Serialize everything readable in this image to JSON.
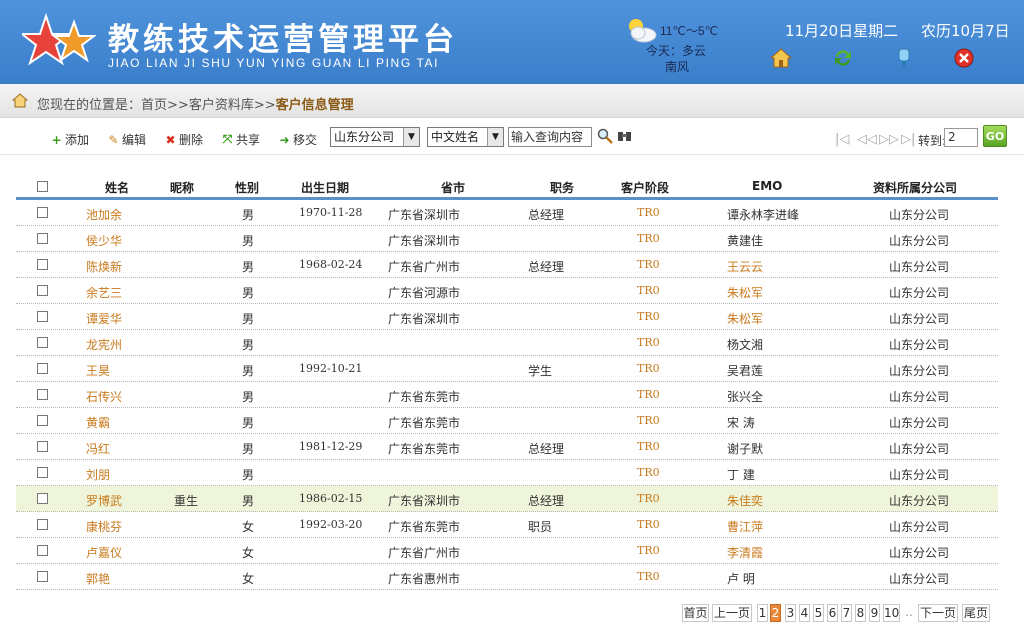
{
  "header": {
    "title": "教练技术运营管理平台",
    "subtitle": "JIAO LIAN JI SHU YUN YING GUAN LI PING TAI",
    "weather": {
      "temp": "11℃～5℃",
      "today": "今天：多云",
      "wind": "南风",
      "icon": "cloudy-sun-icon"
    },
    "date": "11月20日星期二",
    "lunar": "农历10月7日",
    "icons": [
      "home-icon",
      "refresh-icon",
      "help-icon",
      "close-icon"
    ]
  },
  "breadcrumb": {
    "prefix": "您现在的位置是：",
    "home": "首页",
    "sep1": ">>客户资料库>>",
    "current": "客户信息管理"
  },
  "toolbar": {
    "add": "添加",
    "edit": "编辑",
    "delete": "删除",
    "share": "共享",
    "move": "移交",
    "branch_select": "山东分公司",
    "field_select": "中文姓名",
    "search_value": "输入查询内容",
    "goto_label": "转到:",
    "goto_value": "2",
    "go": "GO"
  },
  "table": {
    "headers": [
      "姓名",
      "昵称",
      "性别",
      "出生日期",
      "省市",
      "职务",
      "客户阶段",
      "EMO",
      "资料所属分公司"
    ],
    "rows": [
      {
        "name": "池加余",
        "nick": "",
        "sex": "男",
        "birth": "1970-11-28",
        "city": "广东省深圳市",
        "title": "总经理",
        "stage": "TR0",
        "emo": "谭永林李进峰",
        "emo_link": false,
        "branch": "山东分公司"
      },
      {
        "name": "侯少华",
        "nick": "",
        "sex": "男",
        "birth": "",
        "city": "广东省深圳市",
        "title": "",
        "stage": "TR0",
        "emo": "黄建佳",
        "emo_link": false,
        "branch": "山东分公司"
      },
      {
        "name": "陈焕新",
        "nick": "",
        "sex": "男",
        "birth": "1968-02-24",
        "city": "广东省广州市",
        "title": "总经理",
        "stage": "TR0",
        "emo": "王云云",
        "emo_link": true,
        "branch": "山东分公司"
      },
      {
        "name": "余艺三",
        "nick": "",
        "sex": "男",
        "birth": "",
        "city": "广东省河源市",
        "title": "",
        "stage": "TR0",
        "emo": "朱松军",
        "emo_link": true,
        "branch": "山东分公司"
      },
      {
        "name": "谭爱华",
        "nick": "",
        "sex": "男",
        "birth": "",
        "city": "广东省深圳市",
        "title": "",
        "stage": "TR0",
        "emo": "朱松军",
        "emo_link": true,
        "branch": "山东分公司"
      },
      {
        "name": "龙宪州",
        "nick": "",
        "sex": "男",
        "birth": "",
        "city": "",
        "title": "",
        "stage": "TR0",
        "emo": "杨文湘",
        "emo_link": false,
        "branch": "山东分公司"
      },
      {
        "name": "王昊",
        "nick": "",
        "sex": "男",
        "birth": "1992-10-21",
        "city": "",
        "title": "学生",
        "stage": "TR0",
        "emo": "吴君莲",
        "emo_link": false,
        "branch": "山东分公司"
      },
      {
        "name": "石传兴",
        "nick": "",
        "sex": "男",
        "birth": "",
        "city": "广东省东莞市",
        "title": "",
        "stage": "TR0",
        "emo": "张兴全",
        "emo_link": false,
        "branch": "山东分公司"
      },
      {
        "name": "黄霸",
        "nick": "",
        "sex": "男",
        "birth": "",
        "city": "广东省东莞市",
        "title": "",
        "stage": "TR0",
        "emo": "宋 涛",
        "emo_link": false,
        "branch": "山东分公司"
      },
      {
        "name": "冯红",
        "nick": "",
        "sex": "男",
        "birth": "1981-12-29",
        "city": "广东省东莞市",
        "title": "总经理",
        "stage": "TR0",
        "emo": "谢子默",
        "emo_link": false,
        "branch": "山东分公司"
      },
      {
        "name": "刘朋",
        "nick": "",
        "sex": "男",
        "birth": "",
        "city": "",
        "title": "",
        "stage": "TR0",
        "emo": "丁 建",
        "emo_link": false,
        "branch": "山东分公司"
      },
      {
        "name": "罗博武",
        "nick": "重生",
        "sex": "男",
        "birth": "1986-02-15",
        "city": "广东省深圳市",
        "title": "总经理",
        "stage": "TR0",
        "emo": "朱佳奕",
        "emo_link": true,
        "branch": "山东分公司",
        "highlight": true
      },
      {
        "name": "康桃芬",
        "nick": "",
        "sex": "女",
        "birth": "1992-03-20",
        "city": "广东省东莞市",
        "title": "职员",
        "stage": "TR0",
        "emo": "曹江萍",
        "emo_link": true,
        "branch": "山东分公司"
      },
      {
        "name": "卢嘉仪",
        "nick": "",
        "sex": "女",
        "birth": "",
        "city": "广东省广州市",
        "title": "",
        "stage": "TR0",
        "emo": "李清霞",
        "emo_link": true,
        "branch": "山东分公司"
      },
      {
        "name": "郭艳",
        "nick": "",
        "sex": "女",
        "birth": "",
        "city": "广东省惠州市",
        "title": "",
        "stage": "TR0",
        "emo": "卢 明",
        "emo_link": false,
        "branch": "山东分公司"
      }
    ]
  },
  "pager": {
    "first": "首页",
    "prev": "上一页",
    "pages": [
      "1",
      "2",
      "3",
      "4",
      "5",
      "6",
      "7",
      "8",
      "9",
      "10"
    ],
    "current": "2",
    "ellipsis": "..",
    "next": "下一页",
    "last": "尾页"
  },
  "colors": {
    "header_blue": "#3b7fcb",
    "link_orange": "#c87a1c",
    "highlight_row": "#eef5da",
    "current_page": "#e8893a"
  }
}
